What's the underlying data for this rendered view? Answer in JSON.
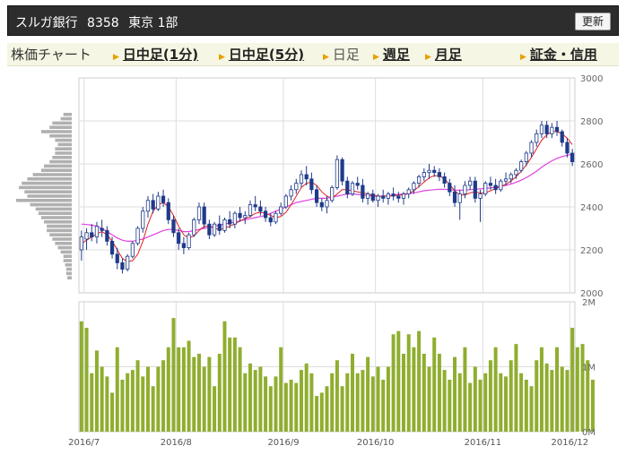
{
  "header": {
    "stock_name": "スルガ銀行",
    "code": "8358",
    "market": "東京 1部",
    "refresh_label": "更新"
  },
  "tabs": [
    {
      "label": "株価チャート",
      "style": "label"
    },
    {
      "label": "日中足(1分)",
      "style": "link"
    },
    {
      "label": "日中足(5分)",
      "style": "link"
    },
    {
      "label": "日足",
      "style": "plain"
    },
    {
      "label": "週足",
      "style": "link"
    },
    {
      "label": "月足",
      "style": "link"
    },
    {
      "label": "証金・信用",
      "style": "link"
    }
  ],
  "colors": {
    "up_candle": "#ffffff",
    "down_candle": "#1f3a8a",
    "candle_outline": "#1f3a8a",
    "ma_short": "#e02020",
    "ma_long": "#e040e0",
    "volume_bar": "#8fae2f",
    "volume_profile": "#b0b0b0",
    "grid": "#dddddd"
  },
  "chart_data": [
    {
      "type": "candlestick",
      "x_ticks": [
        "2016/7",
        "2016/8",
        "2016/9",
        "2016/10",
        "2016/11",
        "2016/12"
      ],
      "y_ticks": [
        "2000",
        "2200",
        "2400",
        "2600",
        "2800",
        "3000"
      ],
      "ylim": [
        2000,
        3000
      ],
      "ohlc": [
        [
          2200,
          2290,
          2150,
          2260
        ],
        [
          2250,
          2300,
          2200,
          2280
        ],
        [
          2280,
          2320,
          2240,
          2260
        ],
        [
          2260,
          2330,
          2230,
          2310
        ],
        [
          2300,
          2340,
          2260,
          2290
        ],
        [
          2290,
          2310,
          2220,
          2240
        ],
        [
          2240,
          2260,
          2160,
          2180
        ],
        [
          2180,
          2210,
          2110,
          2140
        ],
        [
          2140,
          2160,
          2090,
          2110
        ],
        [
          2110,
          2180,
          2100,
          2170
        ],
        [
          2170,
          2240,
          2160,
          2230
        ],
        [
          2230,
          2310,
          2220,
          2300
        ],
        [
          2300,
          2400,
          2280,
          2380
        ],
        [
          2380,
          2450,
          2350,
          2430
        ],
        [
          2430,
          2460,
          2370,
          2390
        ],
        [
          2390,
          2470,
          2380,
          2450
        ],
        [
          2450,
          2480,
          2400,
          2420
        ],
        [
          2420,
          2440,
          2320,
          2340
        ],
        [
          2340,
          2360,
          2260,
          2280
        ],
        [
          2280,
          2300,
          2200,
          2230
        ],
        [
          2230,
          2260,
          2180,
          2210
        ],
        [
          2210,
          2280,
          2200,
          2270
        ],
        [
          2270,
          2350,
          2260,
          2340
        ],
        [
          2340,
          2420,
          2320,
          2400
        ],
        [
          2400,
          2420,
          2300,
          2320
        ],
        [
          2320,
          2340,
          2250,
          2270
        ],
        [
          2270,
          2330,
          2260,
          2320
        ],
        [
          2320,
          2360,
          2270,
          2290
        ],
        [
          2290,
          2350,
          2280,
          2340
        ],
        [
          2340,
          2380,
          2300,
          2320
        ],
        [
          2320,
          2380,
          2300,
          2370
        ],
        [
          2370,
          2400,
          2330,
          2350
        ],
        [
          2350,
          2380,
          2320,
          2360
        ],
        [
          2360,
          2430,
          2350,
          2410
        ],
        [
          2410,
          2450,
          2380,
          2400
        ],
        [
          2400,
          2430,
          2360,
          2380
        ],
        [
          2380,
          2400,
          2330,
          2350
        ],
        [
          2350,
          2370,
          2310,
          2330
        ],
        [
          2330,
          2380,
          2320,
          2370
        ],
        [
          2370,
          2420,
          2360,
          2400
        ],
        [
          2400,
          2460,
          2390,
          2450
        ],
        [
          2450,
          2500,
          2430,
          2480
        ],
        [
          2480,
          2530,
          2460,
          2510
        ],
        [
          2510,
          2570,
          2490,
          2550
        ],
        [
          2550,
          2590,
          2500,
          2530
        ],
        [
          2530,
          2560,
          2460,
          2480
        ],
        [
          2480,
          2500,
          2400,
          2420
        ],
        [
          2420,
          2440,
          2380,
          2400
        ],
        [
          2400,
          2450,
          2370,
          2430
        ],
        [
          2430,
          2500,
          2420,
          2490
        ],
        [
          2490,
          2640,
          2480,
          2620
        ],
        [
          2620,
          2630,
          2500,
          2520
        ],
        [
          2520,
          2540,
          2440,
          2460
        ],
        [
          2460,
          2520,
          2450,
          2510
        ],
        [
          2510,
          2540,
          2480,
          2500
        ],
        [
          2500,
          2530,
          2420,
          2440
        ],
        [
          2440,
          2470,
          2410,
          2460
        ],
        [
          2460,
          2480,
          2420,
          2430
        ],
        [
          2430,
          2460,
          2400,
          2450
        ],
        [
          2450,
          2480,
          2420,
          2440
        ],
        [
          2440,
          2470,
          2410,
          2460
        ],
        [
          2460,
          2490,
          2430,
          2450
        ],
        [
          2450,
          2470,
          2420,
          2440
        ],
        [
          2440,
          2470,
          2410,
          2460
        ],
        [
          2460,
          2490,
          2440,
          2480
        ],
        [
          2480,
          2520,
          2460,
          2510
        ],
        [
          2510,
          2550,
          2490,
          2540
        ],
        [
          2540,
          2580,
          2520,
          2560
        ],
        [
          2560,
          2600,
          2530,
          2570
        ],
        [
          2570,
          2590,
          2540,
          2560
        ],
        [
          2560,
          2580,
          2520,
          2540
        ],
        [
          2540,
          2560,
          2490,
          2510
        ],
        [
          2510,
          2530,
          2450,
          2470
        ],
        [
          2470,
          2500,
          2400,
          2420
        ],
        [
          2420,
          2480,
          2340,
          2460
        ],
        [
          2460,
          2520,
          2440,
          2500
        ],
        [
          2500,
          2540,
          2480,
          2520
        ],
        [
          2520,
          2540,
          2420,
          2440
        ],
        [
          2440,
          2480,
          2330,
          2460
        ],
        [
          2460,
          2520,
          2450,
          2510
        ],
        [
          2510,
          2540,
          2480,
          2500
        ],
        [
          2500,
          2530,
          2460,
          2480
        ],
        [
          2480,
          2530,
          2470,
          2520
        ],
        [
          2520,
          2560,
          2500,
          2530
        ],
        [
          2530,
          2560,
          2510,
          2550
        ],
        [
          2550,
          2580,
          2530,
          2570
        ],
        [
          2570,
          2620,
          2560,
          2610
        ],
        [
          2610,
          2660,
          2590,
          2650
        ],
        [
          2650,
          2710,
          2630,
          2700
        ],
        [
          2700,
          2760,
          2680,
          2740
        ],
        [
          2740,
          2800,
          2720,
          2780
        ],
        [
          2780,
          2800,
          2720,
          2740
        ],
        [
          2740,
          2790,
          2720,
          2770
        ],
        [
          2770,
          2800,
          2730,
          2750
        ],
        [
          2750,
          2760,
          2680,
          2700
        ],
        [
          2700,
          2720,
          2630,
          2650
        ],
        [
          2650,
          2670,
          2590,
          2610
        ]
      ],
      "ma_short": [
        2230,
        2245,
        2260,
        2275,
        2285,
        2270,
        2240,
        2200,
        2160,
        2145,
        2150,
        2180,
        2240,
        2320,
        2380,
        2410,
        2420,
        2400,
        2360,
        2310,
        2270,
        2255,
        2265,
        2290,
        2310,
        2310,
        2300,
        2295,
        2300,
        2310,
        2320,
        2335,
        2345,
        2355,
        2370,
        2375,
        2370,
        2360,
        2350,
        2355,
        2375,
        2410,
        2450,
        2490,
        2510,
        2515,
        2500,
        2470,
        2450,
        2440,
        2460,
        2480,
        2480,
        2475,
        2470,
        2465,
        2460,
        2455,
        2450,
        2450,
        2450,
        2452,
        2455,
        2455,
        2462,
        2475,
        2495,
        2515,
        2535,
        2545,
        2545,
        2530,
        2505,
        2475,
        2455,
        2455,
        2465,
        2470,
        2465,
        2465,
        2475,
        2485,
        2495,
        2505,
        2520,
        2540,
        2565,
        2595,
        2630,
        2670,
        2710,
        2735,
        2750,
        2750,
        2740,
        2720,
        2690
      ],
      "ma_long": [
        2320,
        2318,
        2315,
        2310,
        2300,
        2285,
        2270,
        2255,
        2245,
        2240,
        2240,
        2245,
        2250,
        2260,
        2270,
        2280,
        2290,
        2295,
        2295,
        2290,
        2285,
        2285,
        2290,
        2295,
        2300,
        2305,
        2310,
        2315,
        2320,
        2325,
        2330,
        2335,
        2340,
        2345,
        2350,
        2355,
        2360,
        2370,
        2380,
        2390,
        2400,
        2410,
        2420,
        2425,
        2430,
        2435,
        2440,
        2440,
        2440,
        2445,
        2450,
        2455,
        2460,
        2460,
        2458,
        2455,
        2452,
        2450,
        2450,
        2450,
        2452,
        2455,
        2458,
        2460,
        2462,
        2465,
        2470,
        2475,
        2478,
        2480,
        2482,
        2482,
        2480,
        2478,
        2478,
        2478,
        2480,
        2482,
        2484,
        2486,
        2488,
        2492,
        2496,
        2500,
        2506,
        2514,
        2524,
        2536,
        2550,
        2566,
        2584,
        2600,
        2614,
        2626,
        2634,
        2640,
        2644
      ]
    },
    {
      "type": "bar",
      "name": "volume",
      "y_ticks": [
        "0M",
        "1M",
        "2M"
      ],
      "ylim": [
        0,
        2
      ],
      "values": [
        1.7,
        1.6,
        0.9,
        1.25,
        1.0,
        0.85,
        0.6,
        1.3,
        0.8,
        0.9,
        0.95,
        1.1,
        0.85,
        1.0,
        0.7,
        1.0,
        1.1,
        1.3,
        1.75,
        1.3,
        1.3,
        1.4,
        1.15,
        1.2,
        1.0,
        1.15,
        0.7,
        1.2,
        1.7,
        1.45,
        1.45,
        1.3,
        0.9,
        1.05,
        0.95,
        1.0,
        0.85,
        0.7,
        0.85,
        1.3,
        0.75,
        0.8,
        0.75,
        0.95,
        1.05,
        0.9,
        0.55,
        0.6,
        0.7,
        0.9,
        1.1,
        0.7,
        0.9,
        1.2,
        0.9,
        0.95,
        1.15,
        0.85,
        1.0,
        0.8,
        1.0,
        1.5,
        1.55,
        1.2,
        1.5,
        1.3,
        1.55,
        1.2,
        1.0,
        1.45,
        1.2,
        0.95,
        0.8,
        1.15,
        0.9,
        1.3,
        0.75,
        1.0,
        0.8,
        0.9,
        1.1,
        1.3,
        0.9,
        0.85,
        1.1,
        1.35,
        0.9,
        0.8,
        0.7,
        1.1,
        1.3,
        1.05,
        0.95,
        1.3,
        1.0,
        0.95,
        1.6,
        1.3,
        1.35,
        1.1,
        0.8
      ]
    },
    {
      "type": "bar",
      "name": "price-by-volume",
      "orientation": "horizontal",
      "price_levels": [
        2830,
        2810,
        2790,
        2770,
        2750,
        2730,
        2710,
        2690,
        2670,
        2650,
        2630,
        2610,
        2590,
        2570,
        2550,
        2530,
        2510,
        2490,
        2470,
        2450,
        2430,
        2410,
        2390,
        2370,
        2350,
        2330,
        2310,
        2290,
        2270,
        2250,
        2230,
        2210,
        2190,
        2170,
        2150,
        2130,
        2110,
        2090,
        2070
      ],
      "values": [
        0.15,
        0.2,
        0.35,
        0.4,
        0.55,
        0.4,
        0.3,
        0.25,
        0.3,
        0.3,
        0.35,
        0.4,
        0.5,
        0.55,
        0.7,
        0.8,
        0.9,
        0.95,
        0.85,
        0.8,
        1.0,
        0.75,
        0.65,
        0.6,
        0.55,
        0.5,
        0.45,
        0.45,
        0.4,
        0.35,
        0.3,
        0.25,
        0.2,
        0.15,
        0.15,
        0.12,
        0.1,
        0.1,
        0.08
      ]
    }
  ]
}
